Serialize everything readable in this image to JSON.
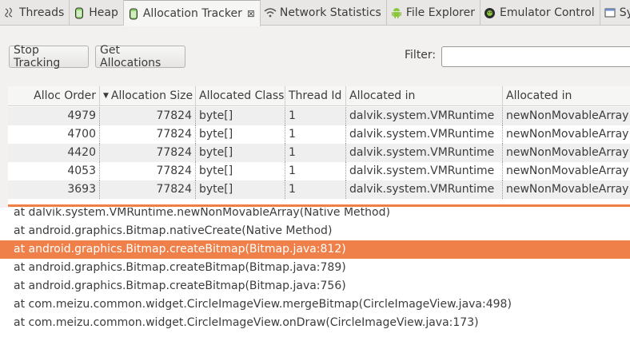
{
  "tabs": [
    {
      "label": "Threads",
      "icon": "threads-icon"
    },
    {
      "label": "Heap",
      "icon": "heap-icon"
    },
    {
      "label": "Allocation Tracker",
      "icon": "allocation-icon",
      "active": true
    },
    {
      "label": "Network Statistics",
      "icon": "network-icon"
    },
    {
      "label": "File Explorer",
      "icon": "android-icon"
    },
    {
      "label": "Emulator Control",
      "icon": "emulator-icon"
    },
    {
      "label": "Syste",
      "icon": "system-icon"
    }
  ],
  "toolbar": {
    "stop_label": "Stop Tracking",
    "get_label": "Get Allocations",
    "filter_label": "Filter:",
    "filter_value": ""
  },
  "table": {
    "columns": [
      "Alloc Order",
      "Allocation Size",
      "Allocated Class",
      "Thread Id",
      "Allocated in",
      "Allocated in"
    ],
    "sort_column": "Allocation Size",
    "rows": [
      [
        "4979",
        "77824",
        "byte[]",
        "1",
        "dalvik.system.VMRuntime",
        "newNonMovableArray"
      ],
      [
        "4700",
        "77824",
        "byte[]",
        "1",
        "dalvik.system.VMRuntime",
        "newNonMovableArray"
      ],
      [
        "4420",
        "77824",
        "byte[]",
        "1",
        "dalvik.system.VMRuntime",
        "newNonMovableArray"
      ],
      [
        "4053",
        "77824",
        "byte[]",
        "1",
        "dalvik.system.VMRuntime",
        "newNonMovableArray"
      ],
      [
        "3693",
        "77824",
        "byte[]",
        "1",
        "dalvik.system.VMRuntime",
        "newNonMovableArray"
      ]
    ]
  },
  "stack": {
    "lines": [
      "at dalvik.system.VMRuntime.newNonMovableArray(Native Method)",
      "at android.graphics.Bitmap.nativeCreate(Native Method)",
      "at android.graphics.Bitmap.createBitmap(Bitmap.java:812)",
      "at android.graphics.Bitmap.createBitmap(Bitmap.java:789)",
      "at android.graphics.Bitmap.createBitmap(Bitmap.java:756)",
      "at com.meizu.common.widget.CircleImageView.mergeBitmap(CircleImageView.java:498)",
      "at com.meizu.common.widget.CircleImageView.onDraw(CircleImageView.java:173)"
    ],
    "selected_index": 2
  },
  "colors": {
    "accent": "#f0804a",
    "selection_text": "#ffffff"
  }
}
